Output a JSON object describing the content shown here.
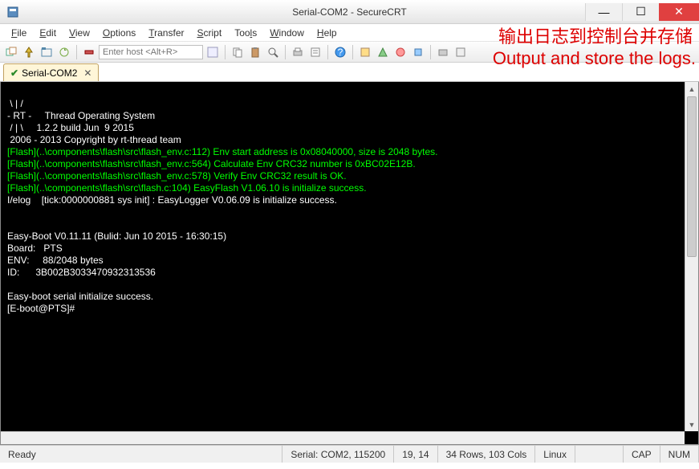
{
  "window": {
    "title": "Serial-COM2 - SecureCRT"
  },
  "menu": {
    "file": "File",
    "edit": "Edit",
    "view": "View",
    "options": "Options",
    "transfer": "Transfer",
    "script": "Script",
    "tools": "Tools",
    "window": "Window",
    "help": "Help"
  },
  "toolbar": {
    "host_placeholder": "Enter host <Alt+R>"
  },
  "tab": {
    "label": "Serial-COM2"
  },
  "overlay": {
    "cn": "输出日志到控制台并存储",
    "en": "Output and store the logs."
  },
  "terminal": {
    "lines": [
      " \\ | /",
      "- RT -     Thread Operating System",
      " / | \\     1.2.2 build Jun  9 2015",
      " 2006 - 2013 Copyright by rt-thread team",
      "[Flash](..\\components\\flash\\src\\flash_env.c:112) Env start address is 0x08040000, size is 2048 bytes.",
      "[Flash](..\\components\\flash\\src\\flash_env.c:564) Calculate Env CRC32 number is 0xBC02E12B.",
      "[Flash](..\\components\\flash\\src\\flash_env.c:578) Verify Env CRC32 result is OK.",
      "[Flash](..\\components\\flash\\src\\flash.c:104) EasyFlash V1.06.10 is initialize success.",
      "I/elog    [tick:0000000881 sys init] : EasyLogger V0.06.09 is initialize success.",
      "",
      "",
      "Easy-Boot V0.11.11 (Bulid: Jun 10 2015 - 16:30:15)",
      "Board:   PTS",
      "ENV:     88/2048 bytes",
      "ID:      3B002B3033470932313536",
      "",
      "Easy-boot serial initialize success.",
      "[E-boot@PTS]#"
    ]
  },
  "status": {
    "ready": "Ready",
    "serial": "Serial: COM2, 115200",
    "cursor": "19, 14",
    "size": "34 Rows, 103 Cols",
    "mode": "Linux",
    "cap": "CAP",
    "num": "NUM"
  }
}
